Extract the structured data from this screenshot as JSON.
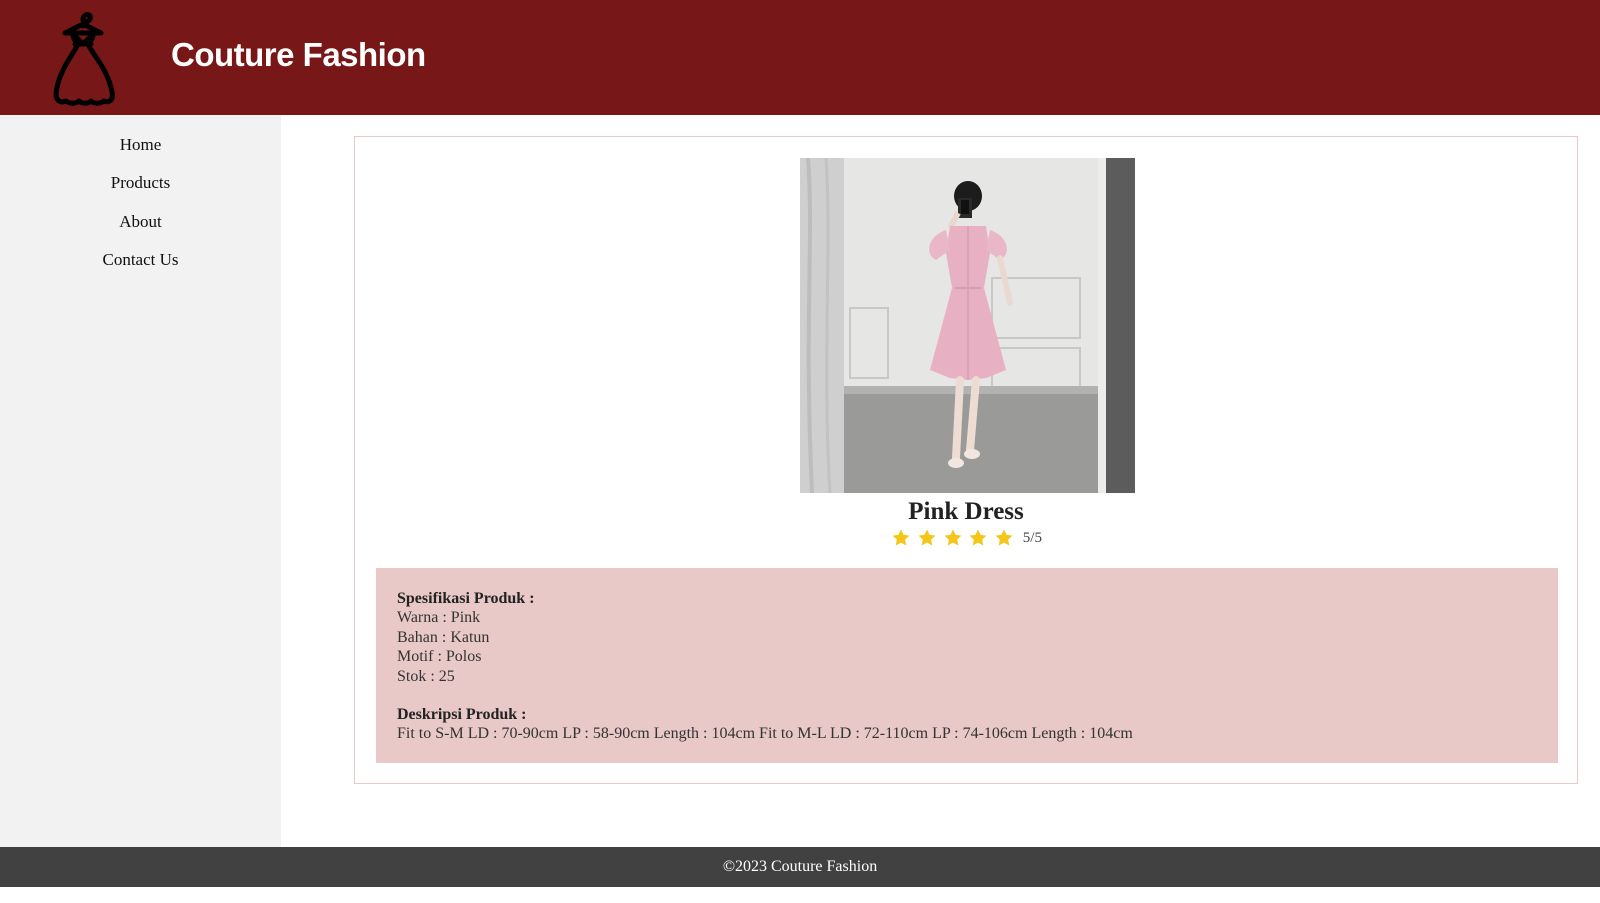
{
  "header": {
    "brand": "Couture Fashion",
    "logo_icon": "dress-icon",
    "background": "#771718"
  },
  "sidebar": {
    "items": [
      {
        "label": "Home"
      },
      {
        "label": "Products"
      },
      {
        "label": "About"
      },
      {
        "label": "Contact Us"
      }
    ]
  },
  "product": {
    "name": "Pink Dress",
    "rating_value": 5,
    "rating_max": 5,
    "rating_text": "5/5",
    "star_icon": "star-icon",
    "star_color": "#f5c518",
    "specs": {
      "heading": "Spesifikasi Produk :",
      "color": "Warna : Pink",
      "material": "Bahan : Katun",
      "motif": "Motif : Polos",
      "stock": "Stok : 25"
    },
    "description": {
      "heading": "Deskripsi Produk :",
      "text": "Fit to S-M LD : 70-90cm LP : 58-90cm Length : 104cm Fit to M-L LD : 72-110cm LP : 74-106cm Length : 104cm"
    },
    "spec_box_color": "#e9c8c8"
  },
  "footer": {
    "text": "©2023 Couture Fashion"
  }
}
